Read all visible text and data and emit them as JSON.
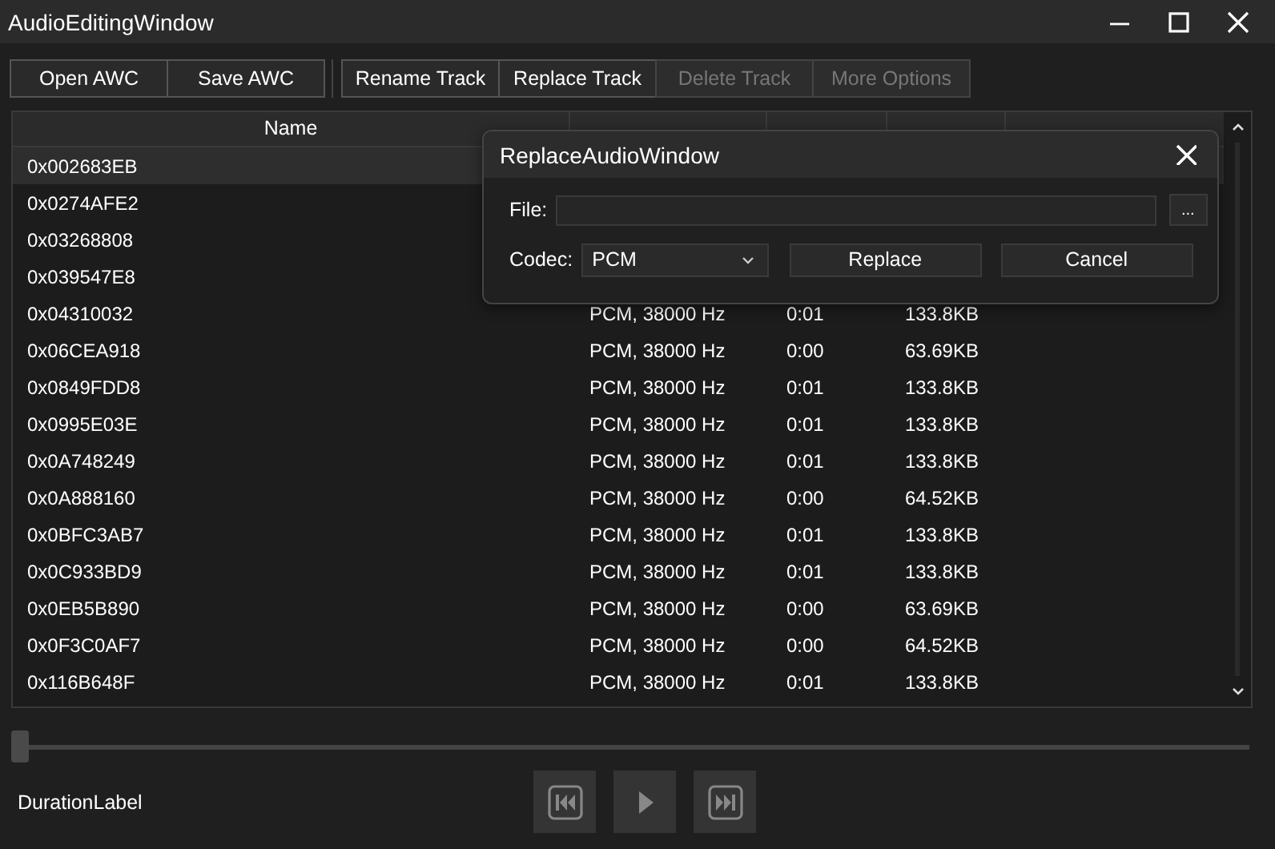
{
  "window": {
    "title": "AudioEditingWindow"
  },
  "toolbar": [
    {
      "label": "Open AWC",
      "disabled": false
    },
    {
      "label": "Save AWC",
      "disabled": false
    },
    {
      "label": "Rename Track",
      "disabled": false,
      "group_start": true
    },
    {
      "label": "Replace Track",
      "disabled": false
    },
    {
      "label": "Delete Track",
      "disabled": true
    },
    {
      "label": "More Options",
      "disabled": true
    }
  ],
  "table": {
    "columns": [
      "Name"
    ],
    "rows": [
      {
        "name": "0x002683EB",
        "selected": true
      },
      {
        "name": "0x0274AFE2",
        "selected": false
      },
      {
        "name": "0x03268808",
        "selected": false
      },
      {
        "name": "0x039547E8",
        "selected": false
      },
      {
        "name": "0x04310032",
        "type": "PCM, 38000 Hz",
        "length": "0:01",
        "size": "133.8KB",
        "selected": false
      },
      {
        "name": "0x06CEA918",
        "type": "PCM, 38000 Hz",
        "length": "0:00",
        "size": "63.69KB",
        "selected": false
      },
      {
        "name": "0x0849FDD8",
        "type": "PCM, 38000 Hz",
        "length": "0:01",
        "size": "133.8KB",
        "selected": false
      },
      {
        "name": "0x0995E03E",
        "type": "PCM, 38000 Hz",
        "length": "0:01",
        "size": "133.8KB",
        "selected": false
      },
      {
        "name": "0x0A748249",
        "type": "PCM, 38000 Hz",
        "length": "0:01",
        "size": "133.8KB",
        "selected": false
      },
      {
        "name": "0x0A888160",
        "type": "PCM, 38000 Hz",
        "length": "0:00",
        "size": "64.52KB",
        "selected": false
      },
      {
        "name": "0x0BFC3AB7",
        "type": "PCM, 38000 Hz",
        "length": "0:01",
        "size": "133.8KB",
        "selected": false
      },
      {
        "name": "0x0C933BD9",
        "type": "PCM, 38000 Hz",
        "length": "0:01",
        "size": "133.8KB",
        "selected": false
      },
      {
        "name": "0x0EB5B890",
        "type": "PCM, 38000 Hz",
        "length": "0:00",
        "size": "63.69KB",
        "selected": false
      },
      {
        "name": "0x0F3C0AF7",
        "type": "PCM, 38000 Hz",
        "length": "0:00",
        "size": "64.52KB",
        "selected": false
      },
      {
        "name": "0x116B648F",
        "type": "PCM, 38000 Hz",
        "length": "0:01",
        "size": "133.8KB",
        "selected": false
      }
    ]
  },
  "player": {
    "position": {
      "level": 0.0
    },
    "duration_label": "DurationLabel"
  },
  "dialog": {
    "title": "ReplaceAudioWindow",
    "file_label": "File:",
    "browse_button": "...",
    "codec_label": "Codec:",
    "codec": "PCM",
    "buttons": [
      "Replace",
      "Cancel"
    ]
  }
}
